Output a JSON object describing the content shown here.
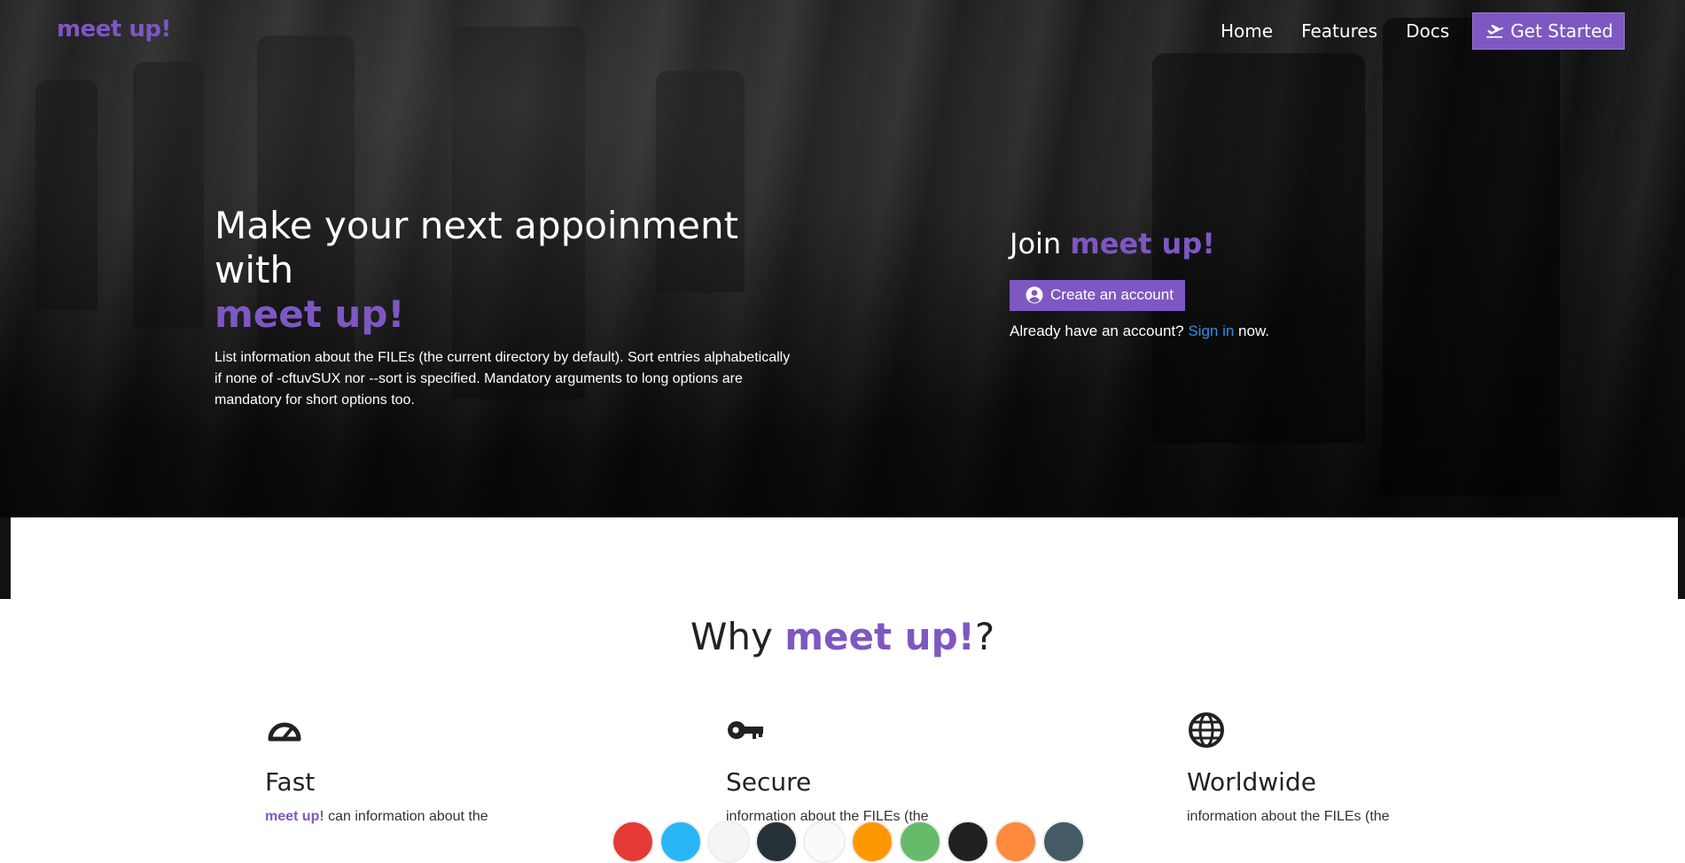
{
  "brand": "meet up!",
  "nav": {
    "items": [
      "Home",
      "Features",
      "Docs"
    ],
    "cta_label": "Get Started",
    "cta_icon": "plane-departure-icon"
  },
  "hero": {
    "headline_prefix": "Make your next appoinment with",
    "headline_accent": "meet up!",
    "description": "List information about the FILEs (the current directory by default). Sort entries alphabetically if none of -cftuvSUX nor --sort is specified. Mandatory arguments to long options are mandatory for short options too."
  },
  "join": {
    "prefix": "Join",
    "accent": "meet up!",
    "create_label": "Create an account",
    "create_icon": "user-circle-icon",
    "signin_prefix": "Already have an account?",
    "signin_link": "Sign in",
    "signin_suffix": "now."
  },
  "why": {
    "prefix": "Why",
    "accent": "meet up!",
    "suffix": "?"
  },
  "features": [
    {
      "title": "Fast",
      "icon": "speedometer-icon",
      "text_accent": "meet up!",
      "text": "can information about the"
    },
    {
      "title": "Secure",
      "icon": "key-icon",
      "text_accent": "",
      "text": "information about the FILEs (the"
    },
    {
      "title": "Worldwide",
      "icon": "globe-icon",
      "text_accent": "",
      "text": "information about the FILEs (the"
    }
  ],
  "colors": {
    "accent": "#7e57c2",
    "link": "#2f8fe8",
    "circle_row": [
      "#e53935",
      "#29b6f6",
      "#f5f5f5",
      "#263238",
      "#fafafa",
      "#ff9800",
      "#66bb6a",
      "#212121",
      "#ff8a3d",
      "#455a64"
    ]
  }
}
